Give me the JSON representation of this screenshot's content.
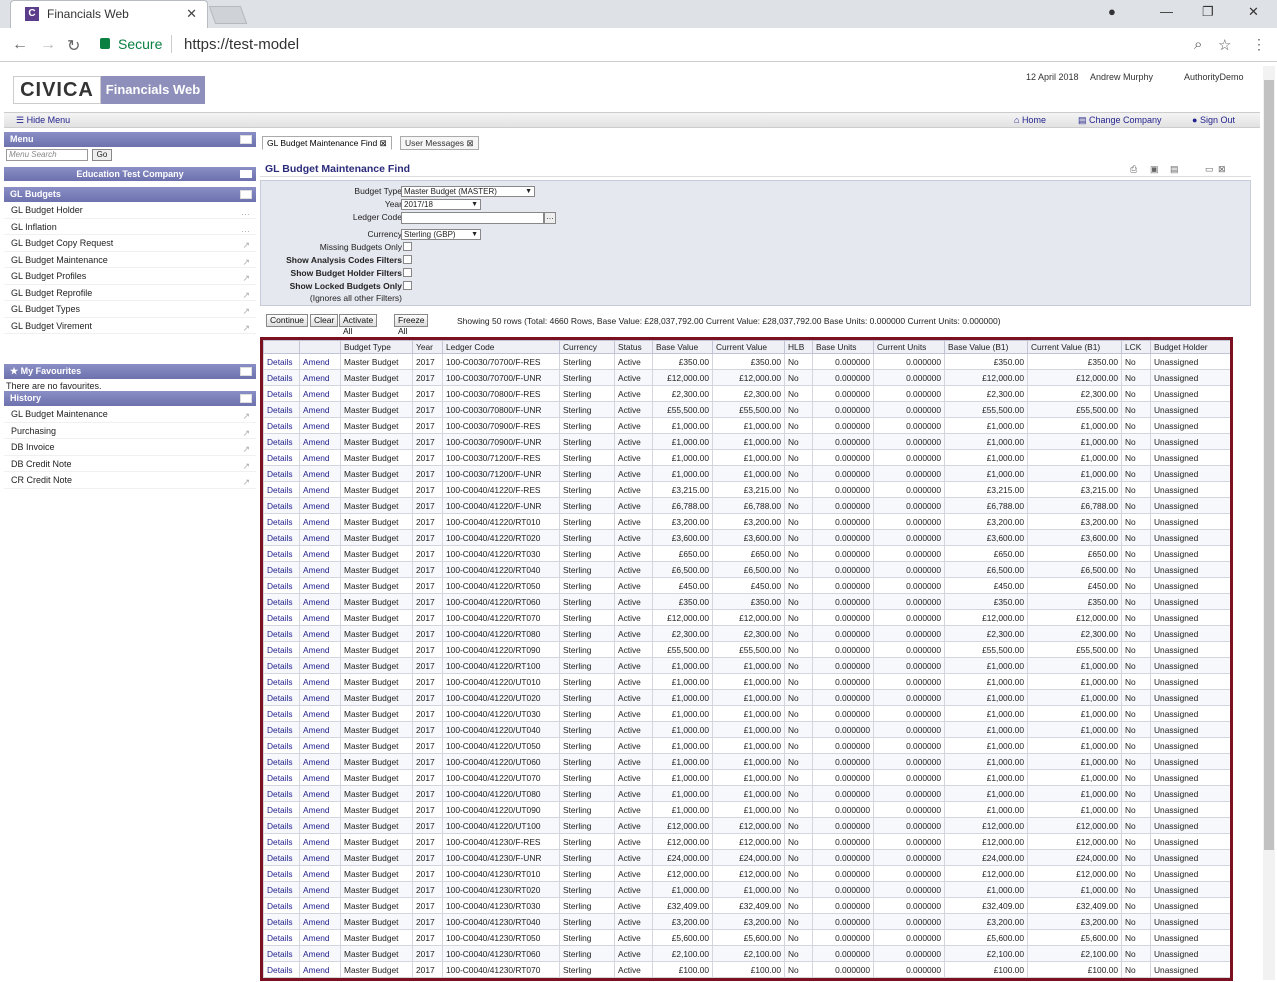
{
  "browser": {
    "tab_title": "Financials Web",
    "secure_label": "Secure",
    "url": "https://test-model"
  },
  "header": {
    "logo_text": "CIVICA",
    "app_name": "Financials Web",
    "date": "12 April 2018",
    "user": "Andrew Murphy",
    "instance": "AuthorityDemo"
  },
  "toolbar": {
    "hide_menu": "Hide Menu",
    "home": "Home",
    "change_company": "Change Company",
    "sign_out": "Sign Out"
  },
  "sidebar": {
    "menu_title": "Menu",
    "search_placeholder": "Menu Search",
    "go_label": "Go",
    "company": "Education Test Company",
    "section": "GL Budgets",
    "items": [
      "GL Budget Holder",
      "GL Inflation",
      "GL Budget Copy Request",
      "GL Budget Maintenance",
      "GL Budget Profiles",
      "GL Budget Reprofile",
      "GL Budget Types",
      "GL Budget Virement"
    ],
    "favourites_title": "My Favourites",
    "favourites_empty": "There are no favourites.",
    "history_title": "History",
    "history": [
      "GL Budget Maintenance",
      "Purchasing",
      "DB Invoice",
      "DB Credit Note",
      "CR Credit Note"
    ]
  },
  "tabs": [
    "GL Budget Maintenance Find",
    "User Messages"
  ],
  "page_title": "GL Budget Maintenance Find",
  "filters": {
    "budget_type_label": "Budget Type",
    "budget_type_value": "Master Budget (MASTER)",
    "year_label": "Year",
    "year_value": "2017/18",
    "ledger_code_label": "Ledger Code",
    "currency_label": "Currency",
    "currency_value": "Sterling (GBP)",
    "missing_label": "Missing Budgets Only",
    "analysis_label": "Show Analysis Codes Filters",
    "holder_label": "Show Budget Holder Filters",
    "locked_label": "Show Locked Budgets Only",
    "locked_note": "(Ignores all other Filters)"
  },
  "actions": {
    "continue": "Continue",
    "clear": "Clear",
    "activate_all": "Activate All",
    "freeze_all": "Freeze All",
    "showing": "Showing 50 rows (Total: 4660 Rows, Base Value: £28,037,792.00 Current Value: £28,037,792.00 Base Units: 0.000000 Current Units: 0.000000)"
  },
  "grid": {
    "columns": [
      "",
      "",
      "Budget Type",
      "Year",
      "Ledger Code",
      "Currency",
      "Status",
      "Base Value",
      "Current Value",
      "HLB",
      "Base Units",
      "Current Units",
      "Base Value (B1)",
      "Current Value (B1)",
      "LCK",
      "Budget Holder"
    ],
    "details_label": "Details",
    "amend_label": "Amend",
    "budget_type": "Master Budget",
    "year": "2017",
    "currency": "Sterling",
    "status": "Active",
    "hlb": "No",
    "units": "0.000000",
    "lck": "No",
    "holder": "Unassigned",
    "rows": [
      [
        "100-C0030/70700/F-RES",
        "£350.00"
      ],
      [
        "100-C0030/70700/F-UNR",
        "£12,000.00"
      ],
      [
        "100-C0030/70800/F-RES",
        "£2,300.00"
      ],
      [
        "100-C0030/70800/F-UNR",
        "£55,500.00"
      ],
      [
        "100-C0030/70900/F-RES",
        "£1,000.00"
      ],
      [
        "100-C0030/70900/F-UNR",
        "£1,000.00"
      ],
      [
        "100-C0030/71200/F-RES",
        "£1,000.00"
      ],
      [
        "100-C0030/71200/F-UNR",
        "£1,000.00"
      ],
      [
        "100-C0040/41220/F-RES",
        "£3,215.00"
      ],
      [
        "100-C0040/41220/F-UNR",
        "£6,788.00"
      ],
      [
        "100-C0040/41220/RT010",
        "£3,200.00"
      ],
      [
        "100-C0040/41220/RT020",
        "£3,600.00"
      ],
      [
        "100-C0040/41220/RT030",
        "£650.00"
      ],
      [
        "100-C0040/41220/RT040",
        "£6,500.00"
      ],
      [
        "100-C0040/41220/RT050",
        "£450.00"
      ],
      [
        "100-C0040/41220/RT060",
        "£350.00"
      ],
      [
        "100-C0040/41220/RT070",
        "£12,000.00"
      ],
      [
        "100-C0040/41220/RT080",
        "£2,300.00"
      ],
      [
        "100-C0040/41220/RT090",
        "£55,500.00"
      ],
      [
        "100-C0040/41220/RT100",
        "£1,000.00"
      ],
      [
        "100-C0040/41220/UT010",
        "£1,000.00"
      ],
      [
        "100-C0040/41220/UT020",
        "£1,000.00"
      ],
      [
        "100-C0040/41220/UT030",
        "£1,000.00"
      ],
      [
        "100-C0040/41220/UT040",
        "£1,000.00"
      ],
      [
        "100-C0040/41220/UT050",
        "£1,000.00"
      ],
      [
        "100-C0040/41220/UT060",
        "£1,000.00"
      ],
      [
        "100-C0040/41220/UT070",
        "£1,000.00"
      ],
      [
        "100-C0040/41220/UT080",
        "£1,000.00"
      ],
      [
        "100-C0040/41220/UT090",
        "£1,000.00"
      ],
      [
        "100-C0040/41220/UT100",
        "£12,000.00"
      ],
      [
        "100-C0040/41230/F-RES",
        "£12,000.00"
      ],
      [
        "100-C0040/41230/F-UNR",
        "£24,000.00"
      ],
      [
        "100-C0040/41230/RT010",
        "£12,000.00"
      ],
      [
        "100-C0040/41230/RT020",
        "£1,000.00"
      ],
      [
        "100-C0040/41230/RT030",
        "£32,409.00"
      ],
      [
        "100-C0040/41230/RT040",
        "£3,200.00"
      ],
      [
        "100-C0040/41230/RT050",
        "£5,600.00"
      ],
      [
        "100-C0040/41230/RT060",
        "£2,100.00"
      ],
      [
        "100-C0040/41230/RT070",
        "£100.00"
      ]
    ]
  },
  "colors": {
    "accent": "#6d71ad",
    "highlight_border": "#7a1020",
    "link": "#23238e"
  }
}
